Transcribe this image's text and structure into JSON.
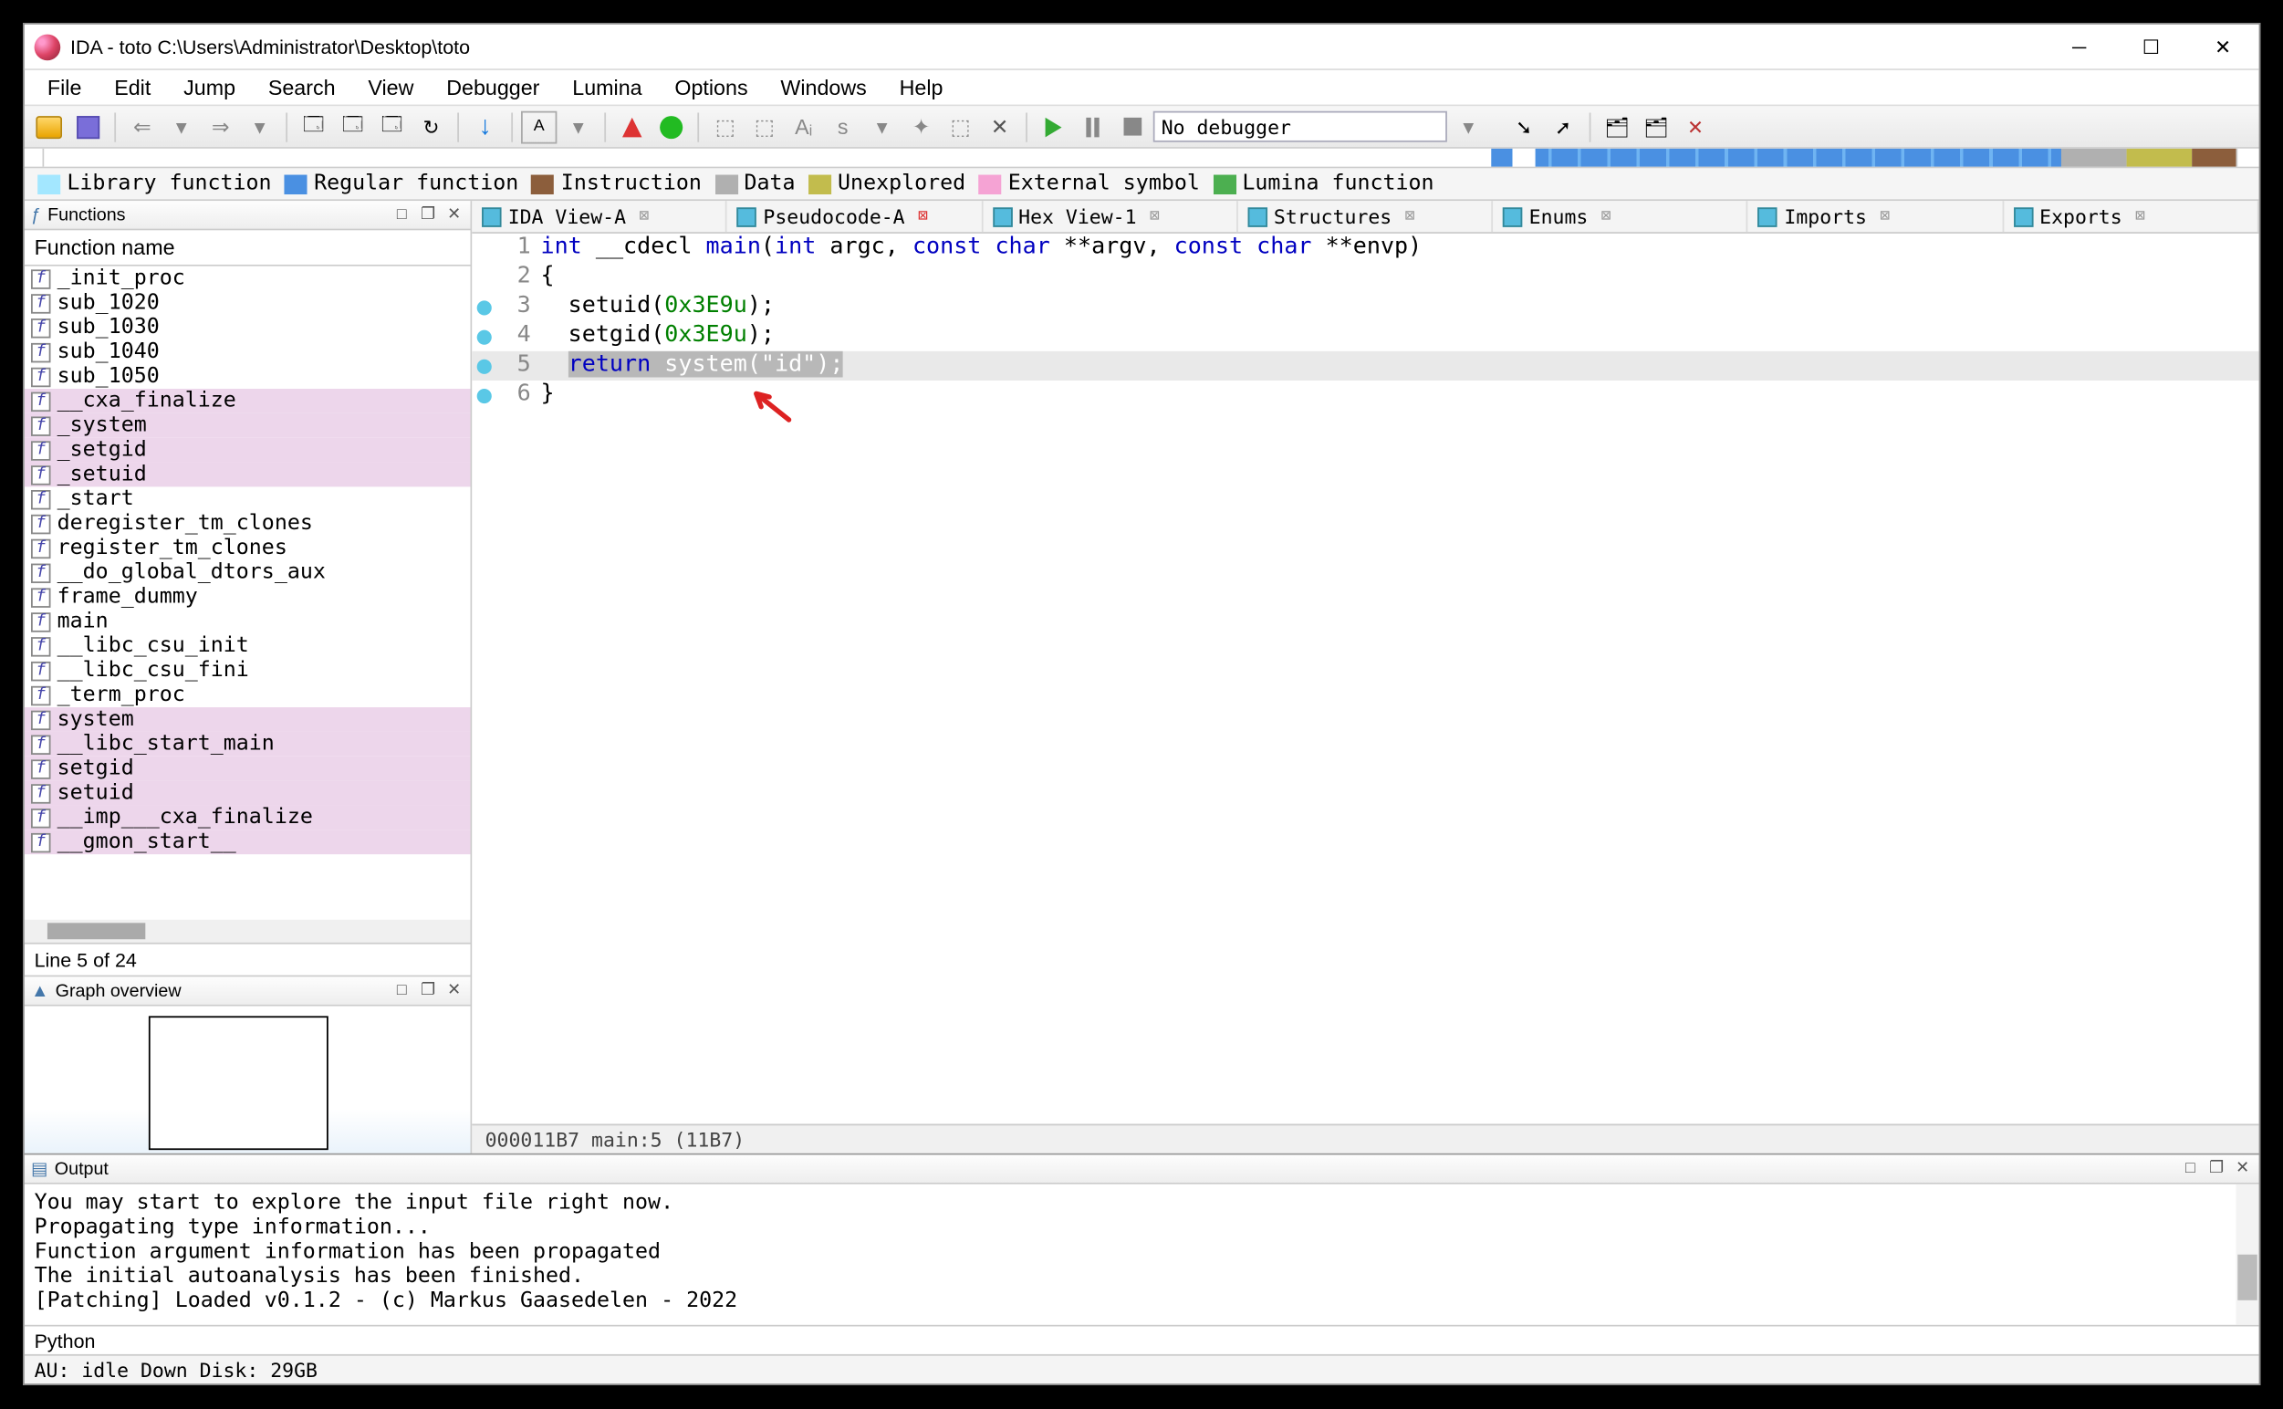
{
  "title": "IDA - toto C:\\Users\\Administrator\\Desktop\\toto",
  "menu": [
    "File",
    "Edit",
    "Jump",
    "Search",
    "View",
    "Debugger",
    "Lumina",
    "Options",
    "Windows",
    "Help"
  ],
  "toolbar": {
    "debugger_text": "No debugger"
  },
  "legend": [
    {
      "color": "#a3e7ff",
      "label": "Library function"
    },
    {
      "color": "#4a90e2",
      "label": "Regular function"
    },
    {
      "color": "#8c5e3c",
      "label": "Instruction"
    },
    {
      "color": "#b0b0b0",
      "label": "Data"
    },
    {
      "color": "#c2bc4d",
      "label": "Unexplored"
    },
    {
      "color": "#f5a3d4",
      "label": "External symbol"
    },
    {
      "color": "#4caf50",
      "label": "Lumina function"
    }
  ],
  "functions_panel": {
    "title": "Functions",
    "header": "Function name",
    "status": "Line 5 of 24",
    "items": [
      {
        "name": "_init_proc",
        "hl": false
      },
      {
        "name": "sub_1020",
        "hl": false
      },
      {
        "name": "sub_1030",
        "hl": false
      },
      {
        "name": "sub_1040",
        "hl": false
      },
      {
        "name": "sub_1050",
        "hl": false
      },
      {
        "name": "__cxa_finalize",
        "hl": true
      },
      {
        "name": "_system",
        "hl": true
      },
      {
        "name": "_setgid",
        "hl": true
      },
      {
        "name": "_setuid",
        "hl": true
      },
      {
        "name": "_start",
        "hl": false
      },
      {
        "name": "deregister_tm_clones",
        "hl": false
      },
      {
        "name": "register_tm_clones",
        "hl": false
      },
      {
        "name": "__do_global_dtors_aux",
        "hl": false
      },
      {
        "name": "frame_dummy",
        "hl": false
      },
      {
        "name": "main",
        "hl": false
      },
      {
        "name": "__libc_csu_init",
        "hl": false
      },
      {
        "name": "__libc_csu_fini",
        "hl": false
      },
      {
        "name": "_term_proc",
        "hl": false
      },
      {
        "name": "system",
        "hl": true
      },
      {
        "name": "__libc_start_main",
        "hl": true
      },
      {
        "name": "setgid",
        "hl": true
      },
      {
        "name": "setuid",
        "hl": true
      },
      {
        "name": "__imp___cxa_finalize",
        "hl": true
      },
      {
        "name": "__gmon_start__",
        "hl": true
      }
    ]
  },
  "graph_panel": {
    "title": "Graph overview"
  },
  "tabs": [
    {
      "label": "IDA View-A",
      "close": "gray"
    },
    {
      "label": "Pseudocode-A",
      "close": "red"
    },
    {
      "label": "Hex View-1",
      "close": "gray"
    },
    {
      "label": "Structures",
      "close": "gray"
    },
    {
      "label": "Enums",
      "close": "gray"
    },
    {
      "label": "Imports",
      "close": "gray"
    },
    {
      "label": "Exports",
      "close": "gray"
    }
  ],
  "code": {
    "lines": [
      {
        "n": 1,
        "bp": false,
        "sel": false,
        "html": "<span class='ty'>int</span> __cdecl <span class='fn'>main</span>(<span class='ty'>int</span> argc, <span class='ty'>const char</span> **argv, <span class='ty'>const char</span> **envp)"
      },
      {
        "n": 2,
        "bp": false,
        "sel": false,
        "html": "{"
      },
      {
        "n": 3,
        "bp": true,
        "sel": false,
        "html": "  setuid(<span class='num'>0x3E9u</span>);"
      },
      {
        "n": 4,
        "bp": true,
        "sel": false,
        "html": "  setgid(<span class='num'>0x3E9u</span>);"
      },
      {
        "n": 5,
        "bp": true,
        "sel": true,
        "html": "  <span class='selspan'><span class='kw'>return</span> system(<span class='str'>\"id\"</span>);</span>"
      },
      {
        "n": 6,
        "bp": true,
        "sel": false,
        "html": "}"
      }
    ],
    "status": "000011B7 main:5 (11B7)"
  },
  "output": {
    "title": "Output",
    "lines": [
      "You may start to explore the input file right now.",
      "Propagating type information...",
      "Function argument information has been propagated",
      "The initial autoanalysis has been finished.",
      "[Patching] Loaded v0.1.2 - (c) Markus Gaasedelen - 2022"
    ]
  },
  "python_label": "Python",
  "status": "AU:  idle   Down  Disk: 29GB"
}
